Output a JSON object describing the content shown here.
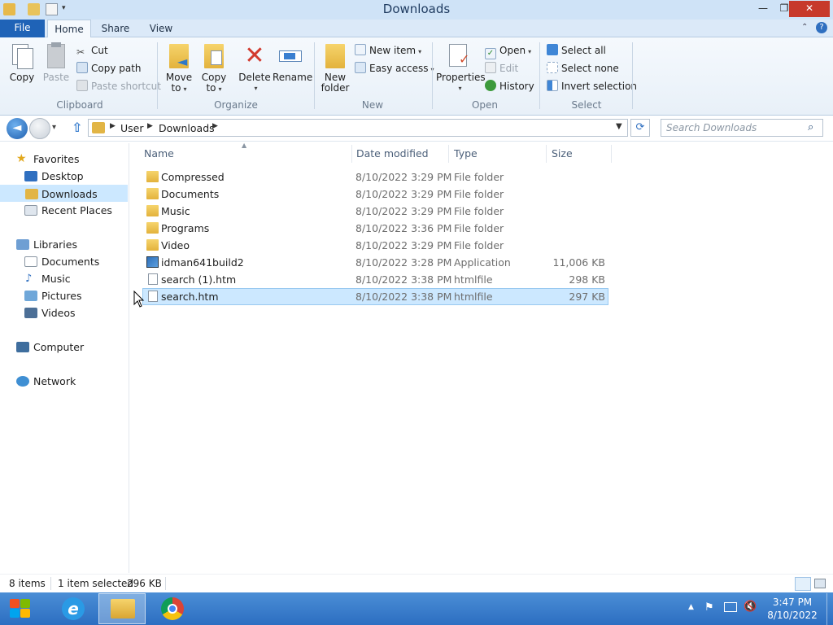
{
  "window": {
    "title": "Downloads",
    "minimize": "—",
    "maximize": "❐",
    "close": "✕"
  },
  "tabs": {
    "file": "File",
    "home": "Home",
    "share": "Share",
    "view": "View"
  },
  "ribbon": {
    "clipboard": {
      "group": "Clipboard",
      "copy": "Copy",
      "paste": "Paste",
      "cut": "Cut",
      "copy_path": "Copy path",
      "paste_shortcut": "Paste shortcut"
    },
    "organize": {
      "group": "Organize",
      "move_to": "Move",
      "move_to2": "to",
      "copy_to": "Copy",
      "copy_to2": "to",
      "delete": "Delete",
      "rename": "Rename"
    },
    "new": {
      "group": "New",
      "new_folder": "New",
      "new_folder2": "folder",
      "new_item": "New item",
      "easy_access": "Easy access"
    },
    "open": {
      "group": "Open",
      "properties": "Properties",
      "open": "Open",
      "edit": "Edit",
      "history": "History"
    },
    "select": {
      "group": "Select",
      "select_all": "Select all",
      "select_none": "Select none",
      "invert_selection": "Invert selection"
    }
  },
  "address": {
    "crumbs": [
      "User",
      "Downloads"
    ],
    "search_placeholder": "Search Downloads"
  },
  "nav": {
    "favorites": "Favorites",
    "desktop": "Desktop",
    "downloads": "Downloads",
    "recent_places": "Recent Places",
    "libraries": "Libraries",
    "documents": "Documents",
    "music": "Music",
    "pictures": "Pictures",
    "videos": "Videos",
    "computer": "Computer",
    "network": "Network"
  },
  "columns": {
    "name": "Name",
    "date": "Date modified",
    "type": "Type",
    "size": "Size"
  },
  "files": [
    {
      "name": "Compressed",
      "date": "8/10/2022 3:29 PM",
      "type": "File folder",
      "size": ""
    },
    {
      "name": "Documents",
      "date": "8/10/2022 3:29 PM",
      "type": "File folder",
      "size": ""
    },
    {
      "name": "Music",
      "date": "8/10/2022 3:29 PM",
      "type": "File folder",
      "size": ""
    },
    {
      "name": "Programs",
      "date": "8/10/2022 3:36 PM",
      "type": "File folder",
      "size": ""
    },
    {
      "name": "Video",
      "date": "8/10/2022 3:29 PM",
      "type": "File folder",
      "size": ""
    },
    {
      "name": "idman641build2",
      "date": "8/10/2022 3:28 PM",
      "type": "Application",
      "size": "11,006 KB"
    },
    {
      "name": "search (1).htm",
      "date": "8/10/2022 3:38 PM",
      "type": "htmlfile",
      "size": "298 KB"
    },
    {
      "name": "search.htm",
      "date": "8/10/2022 3:38 PM",
      "type": "htmlfile",
      "size": "297 KB"
    }
  ],
  "status": {
    "items": "8 items",
    "selected": "1 item selected",
    "size": "296 KB"
  },
  "taskbar": {
    "time": "3:47 PM",
    "date": "8/10/2022"
  },
  "colors": {
    "file_tab": "#1f63b7",
    "selection": "#cce8ff",
    "taskbar": "#2c6ec1",
    "close": "#c7392b"
  }
}
